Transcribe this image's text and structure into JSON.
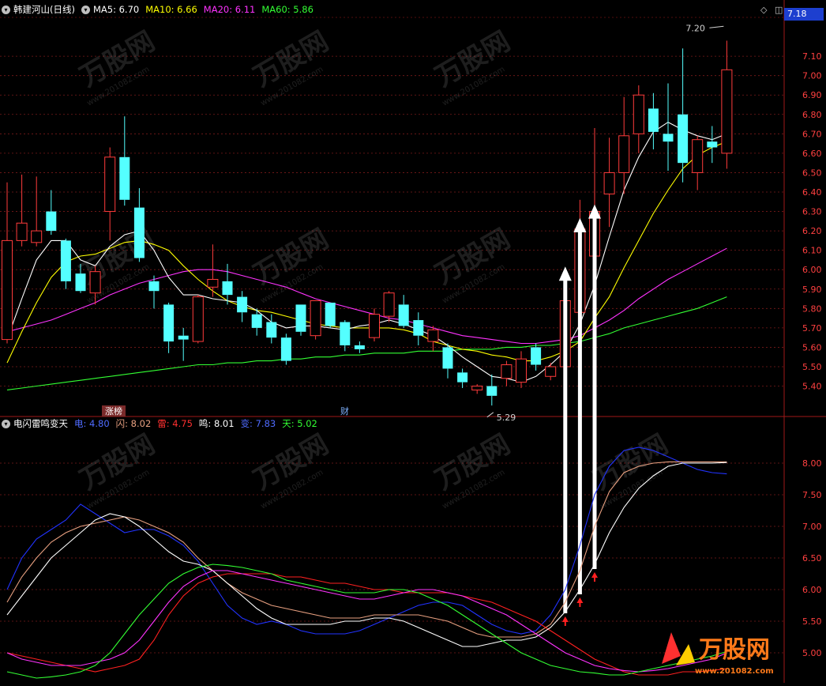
{
  "colors": {
    "up": "#ff3b3b",
    "down": "#54ffff",
    "ma5": "#ffffff",
    "ma10": "#ffff00",
    "ma20": "#ff33ff",
    "ma60": "#33ff33",
    "dian": "#2233ff",
    "shan": "#e8a080",
    "lei": "#ff2020",
    "ming": "#ffffff",
    "bian": "#ff33ff",
    "tian": "#33ff33",
    "grid": "#7a1a1a",
    "axis_text": "#ff4040",
    "border": "#a01818"
  },
  "header": {
    "title": "韩建河山(日线)",
    "ma5_label": "MA5: 6.70",
    "ma10_label": "MA10: 6.66",
    "ma20_label": "MA20: 6.11",
    "ma60_label": "MA60: 5.86",
    "settings_icon": "diamond-icon",
    "panel_icon": "panel-toggle-icon"
  },
  "sub_header": {
    "title": "电闪雷鸣变天",
    "dian_label": "电: 4.80",
    "shan_label": "闪: 8.02",
    "lei_label": "雷: 4.75",
    "ming_label": "鸣: 8.01",
    "bian_label": "变: 7.83",
    "tian_label": "天: 5.02"
  },
  "last_price": "7.18",
  "markers": {
    "zhangbang": "涨榜",
    "cai": "财",
    "high_label": "7.20",
    "low_label": "5.29"
  },
  "watermark": {
    "brand": "万股网",
    "url": "www.201082.com"
  },
  "chart_data": [
    {
      "type": "candlestick",
      "title": "韩建河山(日线)",
      "ylim": [
        5.28,
        7.3
      ],
      "yticks": [
        5.4,
        5.5,
        5.6,
        5.7,
        5.8,
        5.9,
        6.0,
        6.1,
        6.2,
        6.3,
        6.4,
        6.5,
        6.6,
        6.7,
        6.8,
        6.9,
        7.0,
        7.1
      ],
      "candles": [
        {
          "o": 5.64,
          "c": 6.15,
          "h": 6.45,
          "l": 5.62
        },
        {
          "o": 6.15,
          "c": 6.24,
          "h": 6.49,
          "l": 6.12
        },
        {
          "o": 6.14,
          "c": 6.2,
          "h": 6.48,
          "l": 6.12
        },
        {
          "o": 6.3,
          "c": 6.2,
          "h": 6.41,
          "l": 6.18
        },
        {
          "o": 6.15,
          "c": 5.94,
          "h": 6.16,
          "l": 5.9
        },
        {
          "o": 5.98,
          "c": 5.89,
          "h": 6.03,
          "l": 5.88
        },
        {
          "o": 5.88,
          "c": 5.99,
          "h": 6.02,
          "l": 5.82
        },
        {
          "o": 6.3,
          "c": 6.58,
          "h": 6.63,
          "l": 6.15
        },
        {
          "o": 6.58,
          "c": 6.36,
          "h": 6.79,
          "l": 6.33
        },
        {
          "o": 6.32,
          "c": 6.06,
          "h": 6.42,
          "l": 6.04
        },
        {
          "o": 5.94,
          "c": 5.89,
          "h": 5.97,
          "l": 5.8
        },
        {
          "o": 5.82,
          "c": 5.63,
          "h": 5.83,
          "l": 5.57
        },
        {
          "o": 5.66,
          "c": 5.64,
          "h": 5.7,
          "l": 5.53
        },
        {
          "o": 5.63,
          "c": 5.86,
          "h": 5.87,
          "l": 5.62
        },
        {
          "o": 5.91,
          "c": 5.95,
          "h": 6.13,
          "l": 5.86
        },
        {
          "o": 5.94,
          "c": 5.87,
          "h": 6.03,
          "l": 5.82
        },
        {
          "o": 5.86,
          "c": 5.78,
          "h": 5.89,
          "l": 5.73
        },
        {
          "o": 5.77,
          "c": 5.7,
          "h": 5.8,
          "l": 5.66
        },
        {
          "o": 5.73,
          "c": 5.65,
          "h": 5.77,
          "l": 5.62
        },
        {
          "o": 5.65,
          "c": 5.53,
          "h": 5.67,
          "l": 5.51
        },
        {
          "o": 5.82,
          "c": 5.68,
          "h": 5.82,
          "l": 5.66
        },
        {
          "o": 5.66,
          "c": 5.84,
          "h": 5.84,
          "l": 5.64
        },
        {
          "o": 5.83,
          "c": 5.71,
          "h": 5.83,
          "l": 5.7
        },
        {
          "o": 5.73,
          "c": 5.61,
          "h": 5.74,
          "l": 5.58
        },
        {
          "o": 5.61,
          "c": 5.59,
          "h": 5.63,
          "l": 5.57
        },
        {
          "o": 5.65,
          "c": 5.77,
          "h": 5.8,
          "l": 5.63
        },
        {
          "o": 5.76,
          "c": 5.88,
          "h": 5.89,
          "l": 5.73
        },
        {
          "o": 5.82,
          "c": 5.71,
          "h": 5.87,
          "l": 5.7
        },
        {
          "o": 5.74,
          "c": 5.66,
          "h": 5.78,
          "l": 5.61
        },
        {
          "o": 5.63,
          "c": 5.69,
          "h": 5.71,
          "l": 5.58
        },
        {
          "o": 5.6,
          "c": 5.49,
          "h": 5.62,
          "l": 5.44
        },
        {
          "o": 5.47,
          "c": 5.42,
          "h": 5.49,
          "l": 5.39
        },
        {
          "o": 5.38,
          "c": 5.4,
          "h": 5.41,
          "l": 5.36
        },
        {
          "o": 5.4,
          "c": 5.35,
          "h": 5.46,
          "l": 5.3
        },
        {
          "o": 5.44,
          "c": 5.51,
          "h": 5.53,
          "l": 5.4
        },
        {
          "o": 5.42,
          "c": 5.54,
          "h": 5.58,
          "l": 5.39
        },
        {
          "o": 5.6,
          "c": 5.51,
          "h": 5.62,
          "l": 5.48
        },
        {
          "o": 5.45,
          "c": 5.5,
          "h": 5.52,
          "l": 5.43
        },
        {
          "o": 5.5,
          "c": 5.84,
          "h": 5.82,
          "l": 5.43
        },
        {
          "o": 5.78,
          "c": 6.21,
          "h": 6.36,
          "l": 5.77
        },
        {
          "o": 6.07,
          "c": 6.3,
          "h": 6.73,
          "l": 6.05
        },
        {
          "o": 6.39,
          "c": 6.5,
          "h": 6.68,
          "l": 6.22
        },
        {
          "o": 6.5,
          "c": 6.69,
          "h": 6.89,
          "l": 6.39
        },
        {
          "o": 6.7,
          "c": 6.9,
          "h": 6.95,
          "l": 6.6
        },
        {
          "o": 6.83,
          "c": 6.71,
          "h": 6.91,
          "l": 6.62
        },
        {
          "o": 6.7,
          "c": 6.66,
          "h": 6.96,
          "l": 6.51
        },
        {
          "o": 6.8,
          "c": 6.55,
          "h": 7.14,
          "l": 6.45
        },
        {
          "o": 6.5,
          "c": 6.67,
          "h": 6.69,
          "l": 6.41
        },
        {
          "o": 6.66,
          "c": 6.63,
          "h": 6.74,
          "l": 6.55
        },
        {
          "o": 6.6,
          "c": 7.03,
          "h": 7.18,
          "l": 6.52
        }
      ],
      "ma5": [
        5.64,
        5.85,
        6.05,
        6.15,
        6.15,
        6.05,
        6.02,
        6.12,
        6.18,
        6.2,
        6.1,
        5.96,
        5.87,
        5.87,
        5.85,
        5.84,
        5.83,
        5.79,
        5.73,
        5.7,
        5.71,
        5.71,
        5.7,
        5.69,
        5.71,
        5.72,
        5.74,
        5.72,
        5.69,
        5.66,
        5.61,
        5.55,
        5.5,
        5.45,
        5.44,
        5.42,
        5.45,
        5.51,
        5.58,
        5.72,
        5.92,
        6.17,
        6.41,
        6.58,
        6.71,
        6.76,
        6.72,
        6.69,
        6.67,
        6.7
      ],
      "ma10": [
        5.52,
        5.68,
        5.83,
        5.96,
        6.04,
        6.07,
        6.08,
        6.11,
        6.14,
        6.15,
        6.13,
        6.1,
        6.02,
        5.95,
        5.89,
        5.84,
        5.81,
        5.79,
        5.78,
        5.76,
        5.74,
        5.72,
        5.71,
        5.7,
        5.7,
        5.7,
        5.7,
        5.69,
        5.67,
        5.63,
        5.61,
        5.59,
        5.58,
        5.56,
        5.55,
        5.53,
        5.53,
        5.55,
        5.58,
        5.63,
        5.75,
        5.86,
        6.01,
        6.15,
        6.29,
        6.41,
        6.52,
        6.59,
        6.63,
        6.66
      ],
      "ma20": [
        5.68,
        5.7,
        5.72,
        5.74,
        5.77,
        5.8,
        5.83,
        5.87,
        5.9,
        5.93,
        5.95,
        5.97,
        5.99,
        6.0,
        6.0,
        5.99,
        5.97,
        5.95,
        5.93,
        5.91,
        5.88,
        5.85,
        5.83,
        5.81,
        5.79,
        5.77,
        5.75,
        5.74,
        5.72,
        5.7,
        5.68,
        5.66,
        5.65,
        5.64,
        5.63,
        5.62,
        5.62,
        5.63,
        5.64,
        5.66,
        5.7,
        5.74,
        5.79,
        5.85,
        5.9,
        5.95,
        5.99,
        6.03,
        6.07,
        6.11
      ],
      "ma60": [
        5.38,
        5.39,
        5.4,
        5.41,
        5.42,
        5.43,
        5.44,
        5.45,
        5.46,
        5.47,
        5.48,
        5.49,
        5.5,
        5.51,
        5.51,
        5.52,
        5.52,
        5.53,
        5.53,
        5.54,
        5.54,
        5.55,
        5.55,
        5.56,
        5.56,
        5.57,
        5.57,
        5.57,
        5.58,
        5.58,
        5.58,
        5.59,
        5.59,
        5.59,
        5.6,
        5.6,
        5.61,
        5.61,
        5.62,
        5.63,
        5.65,
        5.67,
        5.7,
        5.72,
        5.74,
        5.76,
        5.78,
        5.8,
        5.83,
        5.86
      ]
    },
    {
      "type": "line",
      "title": "电闪雷鸣变天",
      "ylim": [
        4.6,
        8.5
      ],
      "yticks": [
        5.0,
        5.5,
        6.0,
        6.5,
        7.0,
        7.5,
        8.0
      ],
      "series": [
        {
          "name": "电",
          "values": [
            6.0,
            6.5,
            6.8,
            6.95,
            7.1,
            7.35,
            7.2,
            7.05,
            6.9,
            6.95,
            6.95,
            6.85,
            6.7,
            6.45,
            6.1,
            5.75,
            5.55,
            5.45,
            5.5,
            5.45,
            5.35,
            5.3,
            5.3,
            5.3,
            5.35,
            5.45,
            5.55,
            5.65,
            5.75,
            5.8,
            5.8,
            5.75,
            5.6,
            5.45,
            5.35,
            5.3,
            5.35,
            5.6,
            6.0,
            6.7,
            7.5,
            7.95,
            8.2,
            8.25,
            8.2,
            8.1,
            8.0,
            7.9,
            7.85,
            7.83
          ]
        },
        {
          "name": "闪",
          "values": [
            5.8,
            6.2,
            6.5,
            6.75,
            6.9,
            7.0,
            7.05,
            7.1,
            7.15,
            7.1,
            7.0,
            6.9,
            6.75,
            6.5,
            6.3,
            6.1,
            5.95,
            5.85,
            5.75,
            5.7,
            5.65,
            5.6,
            5.55,
            5.55,
            5.55,
            5.6,
            5.6,
            5.6,
            5.6,
            5.55,
            5.5,
            5.4,
            5.3,
            5.25,
            5.25,
            5.25,
            5.3,
            5.45,
            5.8,
            6.3,
            7.0,
            7.55,
            7.85,
            7.95,
            8.0,
            8.02,
            8.02,
            8.02,
            8.02,
            8.02
          ]
        },
        {
          "name": "雷",
          "values": [
            5.0,
            4.95,
            4.9,
            4.85,
            4.8,
            4.75,
            4.7,
            4.75,
            4.8,
            4.9,
            5.2,
            5.6,
            5.9,
            6.1,
            6.2,
            6.25,
            6.25,
            6.25,
            6.25,
            6.2,
            6.2,
            6.15,
            6.1,
            6.1,
            6.05,
            6.0,
            6.0,
            5.95,
            5.95,
            5.95,
            5.95,
            5.9,
            5.85,
            5.8,
            5.7,
            5.6,
            5.5,
            5.35,
            5.2,
            5.05,
            4.9,
            4.8,
            4.7,
            4.65,
            4.65,
            4.65,
            4.7,
            4.7,
            4.72,
            4.75
          ]
        },
        {
          "name": "鸣",
          "values": [
            5.6,
            5.9,
            6.2,
            6.5,
            6.7,
            6.9,
            7.1,
            7.2,
            7.15,
            7.0,
            6.8,
            6.6,
            6.45,
            6.4,
            6.3,
            6.1,
            5.9,
            5.7,
            5.55,
            5.45,
            5.45,
            5.45,
            5.45,
            5.5,
            5.5,
            5.55,
            5.55,
            5.5,
            5.4,
            5.3,
            5.2,
            5.1,
            5.1,
            5.15,
            5.2,
            5.2,
            5.25,
            5.4,
            5.65,
            6.0,
            6.4,
            6.9,
            7.3,
            7.6,
            7.8,
            7.95,
            8.0,
            8.0,
            8.0,
            8.01
          ]
        },
        {
          "name": "变",
          "values": [
            5.0,
            4.9,
            4.85,
            4.8,
            4.8,
            4.8,
            4.85,
            4.9,
            5.0,
            5.2,
            5.5,
            5.8,
            6.05,
            6.2,
            6.3,
            6.3,
            6.25,
            6.2,
            6.15,
            6.1,
            6.05,
            6.0,
            5.95,
            5.9,
            5.85,
            5.85,
            5.9,
            5.95,
            6.0,
            6.0,
            5.95,
            5.9,
            5.8,
            5.7,
            5.6,
            5.45,
            5.3,
            5.15,
            5.0,
            4.9,
            4.8,
            4.75,
            4.72,
            4.7,
            4.72,
            4.75,
            4.8,
            4.85,
            4.9,
            5.0
          ]
        },
        {
          "name": "天",
          "values": [
            4.7,
            4.65,
            4.6,
            4.62,
            4.65,
            4.7,
            4.8,
            5.0,
            5.3,
            5.6,
            5.85,
            6.1,
            6.25,
            6.35,
            6.4,
            6.38,
            6.35,
            6.3,
            6.25,
            6.15,
            6.1,
            6.05,
            6.0,
            5.95,
            5.95,
            5.95,
            6.0,
            6.0,
            5.95,
            5.85,
            5.75,
            5.6,
            5.45,
            5.3,
            5.15,
            5.0,
            4.9,
            4.8,
            4.75,
            4.7,
            4.68,
            4.65,
            4.65,
            4.7,
            4.75,
            4.8,
            4.85,
            4.9,
            4.95,
            5.02
          ]
        }
      ],
      "signal_bars": [
        38,
        39,
        40
      ]
    }
  ]
}
